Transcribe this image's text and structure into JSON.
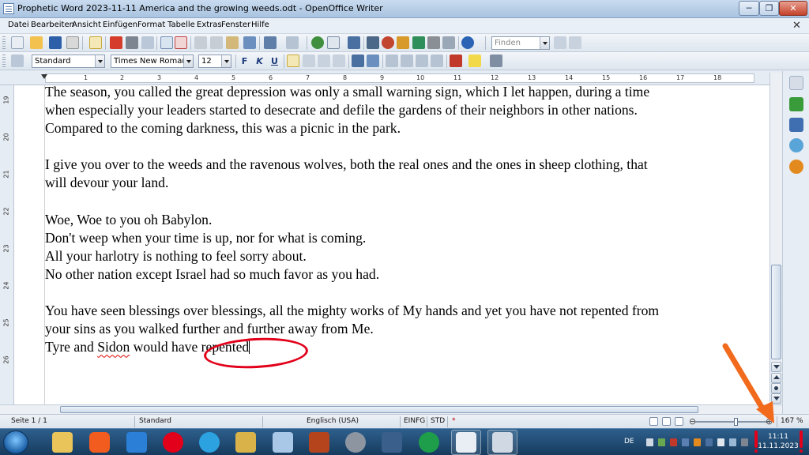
{
  "window": {
    "title": "Prophetic Word 2023-11-11 America and the growing weeds.odt - OpenOffice Writer",
    "min_label": "─",
    "max_label": "❐",
    "close_label": "✕"
  },
  "menu": {
    "items": [
      "Datei",
      "Bearbeiten",
      "Ansicht",
      "Einfügen",
      "Format",
      "Tabelle",
      "Extras",
      "Fenster",
      "Hilfe"
    ],
    "doc_close": "✕"
  },
  "toolbar": {
    "find_placeholder": "Finden",
    "style": "Standard",
    "font": "Times New Roman",
    "size": "12",
    "bold": "F",
    "italic": "K",
    "underline": "U"
  },
  "ruler": {
    "numbers": [
      "1",
      "2",
      "3",
      "4",
      "5",
      "6",
      "7",
      "8",
      "9",
      "10",
      "11",
      "12",
      "13",
      "14",
      "15",
      "16",
      "17",
      "18"
    ],
    "vnumbers": [
      "19",
      "20",
      "21",
      "22",
      "23",
      "24",
      "25",
      "26"
    ]
  },
  "document": {
    "lines": [
      "The season, you called the great depression was only a small warning sign, which I let happen, during a time",
      "when especially your leaders started to desecrate and defile the gardens of their neighbors in other nations.",
      "Compared to the coming darkness, this was a picnic in the park.",
      "",
      "I give you over to the weeds and the ravenous wolves, both the real ones and the ones in sheep clothing, that",
      "will devour your land.",
      "",
      "Woe, Woe to you oh Babylon.",
      "Don't weep when your time is up, nor for what is coming.",
      "All your harlotry is nothing to feel sorry about.",
      "No other nation except Israel had so much favor as you had.",
      "",
      "You have seen blessings over blessings, all the mighty works of My hands and yet you have not repented from",
      "your sins as you walked further and further away from Me."
    ],
    "last_line_prefix": "Tyre and ",
    "last_line_misspelled": "Sidon",
    "last_line_suffix": " would have repented"
  },
  "status": {
    "page": "Seite 1 / 1",
    "style": "Standard",
    "language": "Englisch (USA)",
    "insert_mode": "EINFG",
    "selection_mode": "STD",
    "modified": "*",
    "zoom": "167 %"
  },
  "tray": {
    "language": "DE",
    "time": "11:11",
    "date": "11.11.2023"
  },
  "colors": {
    "annotation_red": "#e2001a",
    "annotation_orange": "#f26a1b",
    "taskbar": "#1f4a73"
  }
}
